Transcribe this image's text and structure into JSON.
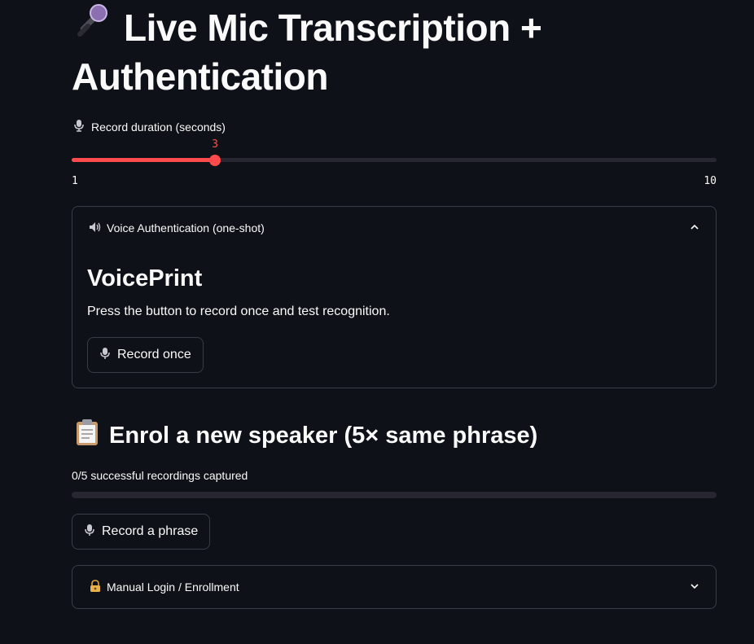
{
  "app": {
    "title_icon": "microphone-emoji",
    "title": "Live Mic Transcription + Authentication"
  },
  "slider": {
    "label_icon": "studio-mic-icon",
    "label": "Record duration (seconds)",
    "min": 1,
    "max": 10,
    "value": 3,
    "min_text": "1",
    "max_text": "10",
    "value_text": "3",
    "accent_color": "#ff4b4b"
  },
  "voice_auth": {
    "header_icon": "speaker-icon",
    "header": "Voice Authentication (one-shot)",
    "expanded": true,
    "subtitle": "VoicePrint",
    "description": "Press the button to record once and test recognition.",
    "button_label": "Record once"
  },
  "enrol": {
    "title_icon": "clipboard-emoji",
    "title": "Enrol a new speaker (5× same phrase)",
    "progress_text": "0/5 successful recordings captured",
    "progress_fraction": 0.0,
    "button_label": "Record a phrase"
  },
  "manual_login": {
    "header_icon": "lock-with-key-icon",
    "header": "Manual Login / Enrollment",
    "expanded": false
  }
}
